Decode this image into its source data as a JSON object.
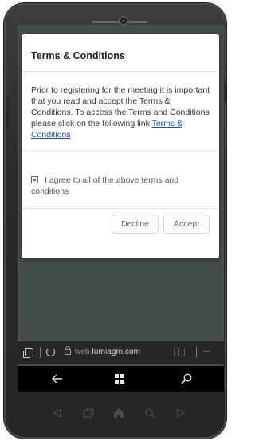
{
  "dialog": {
    "title": "Terms & Conditions",
    "body_text": "Prior to registering for the meeting it is important that you read and accept the Terms & Conditions. To access the Terms and Conditions please click on the following link ",
    "link_text": "Terms & Conditions",
    "agree_text": "I agree to all of the above terms and conditions",
    "agree_checked": true,
    "decline_label": "Decline",
    "accept_label": "Accept"
  },
  "browser": {
    "url_prefix": "web.",
    "url_domain": "lumiagm.com",
    "more_label": "…"
  },
  "icons": {
    "tabs": "tabs-icon",
    "refresh": "refresh-icon",
    "lock": "lock-icon",
    "reading": "reading-view-icon",
    "more": "more-icon",
    "back": "back-arrow-icon",
    "start": "windows-start-icon",
    "search": "search-icon",
    "hw_back": "hardware-back-icon",
    "hw_tasks": "hardware-tasks-icon",
    "hw_home": "hardware-home-icon",
    "hw_search": "hardware-search-icon",
    "hw_forward": "hardware-forward-icon"
  },
  "colors": {
    "screen_bg": "#464d4d",
    "link": "#1a4fd6",
    "dialog_bg": "#ffffff",
    "nav_bg": "#000000"
  }
}
